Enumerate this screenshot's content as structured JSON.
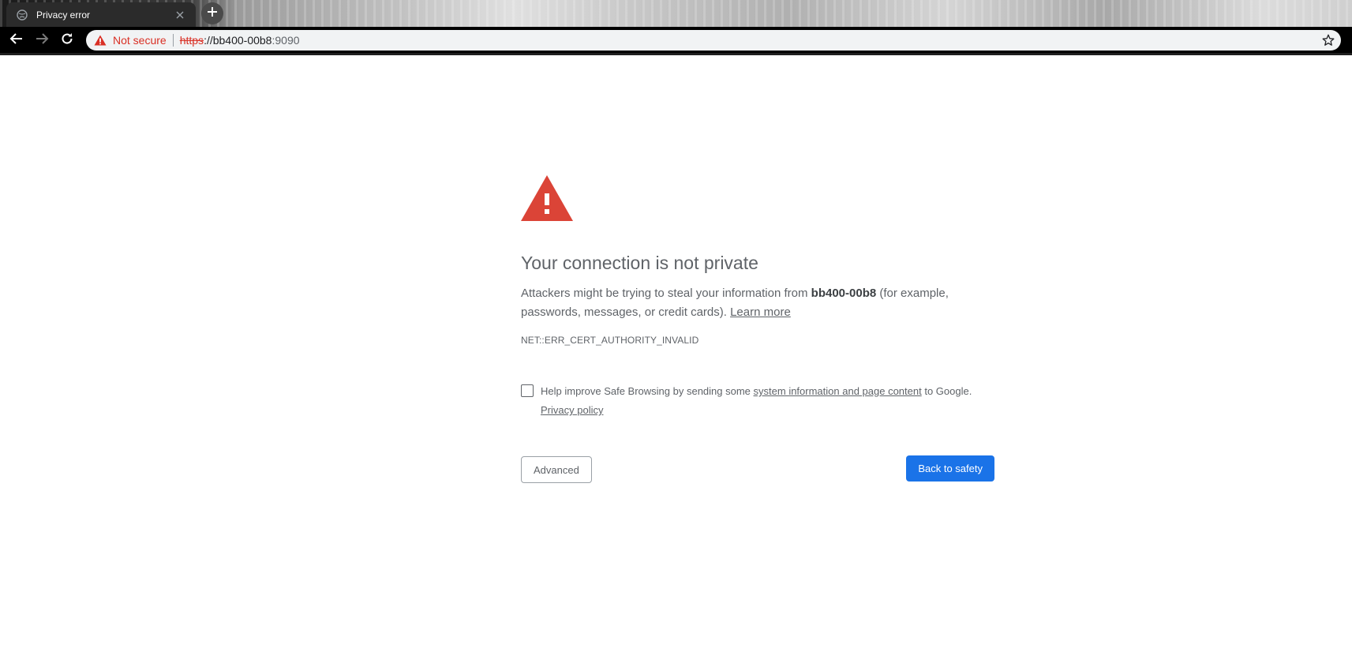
{
  "browser": {
    "tab": {
      "title": "Privacy error"
    },
    "omnibox": {
      "security_label": "Not secure",
      "url_scheme": "https",
      "url_sep": "://",
      "url_host": "bb400-00b8",
      "url_port": ":9090"
    }
  },
  "interstitial": {
    "headline": "Your connection is not private",
    "explanation_prefix": "Attackers might be trying to steal your information from ",
    "host": "bb400-00b8",
    "explanation_suffix": " (for example, passwords, messages, or credit cards). ",
    "learn_more": "Learn more",
    "error_code": "NET::ERR_CERT_AUTHORITY_INVALID",
    "opt_in_prefix": "Help improve Safe Browsing by sending some ",
    "opt_in_link": "system information and page content",
    "opt_in_suffix": " to Google.",
    "privacy_policy": "Privacy policy",
    "opt_in_checked": false,
    "advanced_label": "Advanced",
    "back_label": "Back to safety"
  },
  "colors": {
    "danger": "#d93025",
    "warning_icon": "#db4437",
    "primary_button": "#1a73e8",
    "text": "#5f6368"
  },
  "icons": [
    "globe-icon",
    "close-icon",
    "plus-icon",
    "back-arrow-icon",
    "forward-arrow-icon",
    "reload-icon",
    "warning-triangle-icon",
    "star-icon"
  ]
}
